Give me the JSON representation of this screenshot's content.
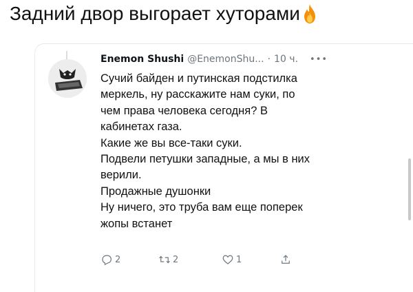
{
  "caption": {
    "text": "Задний двор выгорает хуторами",
    "emoji_icon": "fire-icon"
  },
  "tweet": {
    "author_name": "Enemon Shushi",
    "handle": "@EnemonShu...",
    "separator": "·",
    "time": "10 ч.",
    "more_icon": "more-dots-icon",
    "lines": [
      "Сучий байден и путинская подстилка",
      "меркель, ну расскажите нам суки, по",
      "чем права человека сегодня? В",
      "кабинетах газа.",
      "Какие же вы все-таки суки.",
      "Подвели петушки западные, а мы в них",
      "верили.",
      "Продажные душонки",
      "Ну ничего, это труба вам еще поперек",
      "жопы встанет"
    ],
    "actions": {
      "reply_count": "2",
      "retweet_count": "2",
      "like_count": "1"
    }
  },
  "colors": {
    "text": "#0f1419",
    "muted": "#6e767d",
    "fire": "#f4900c"
  }
}
